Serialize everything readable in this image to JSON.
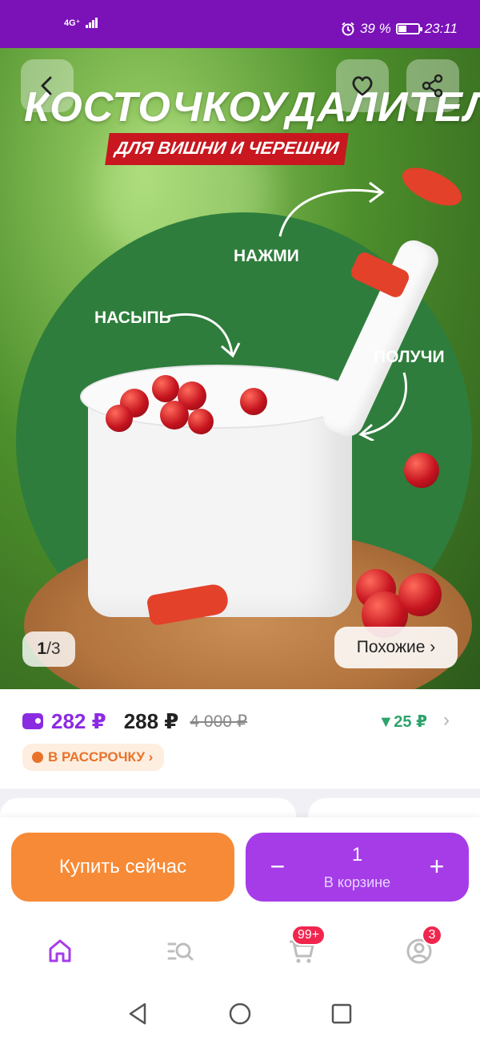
{
  "status_bar": {
    "network": "4G⁺",
    "battery": "39 %",
    "time": "23:11",
    "background": "#7a12b8"
  },
  "hero": {
    "title": "КОСТОЧКОУДАЛИТЕЛЬ",
    "subtitle": "ДЛЯ ВИШНИ И ЧЕРЕШНИ",
    "label_press": "НАЖМИ",
    "label_pour": "НАСЫПЬ",
    "label_get": "ПОЛУЧИ",
    "page_current": "1",
    "page_sep": "/",
    "page_total": "3",
    "similar_label": "Похожие ›",
    "back_icon": "chevron-left-icon",
    "favorite_icon": "heart-icon",
    "share_icon": "share-icon"
  },
  "price": {
    "wallet_price": "282 ₽",
    "main_price": "288 ₽",
    "old_price": "4 000 ₽",
    "price_drop": "▼25 ₽",
    "installment_label": "В РАССРОЧКУ ›",
    "wallet_color": "#8a2be2",
    "drop_color": "#2ea36b",
    "installment_color": "#e8722a"
  },
  "actions": {
    "buy_now_label": "Купить сейчас",
    "minus_label": "−",
    "plus_label": "+",
    "cart_quantity": "1",
    "cart_caption": "В корзине",
    "buy_color": "#f78a36",
    "cart_color": "#a63ce8"
  },
  "bottom_nav": {
    "items": [
      {
        "icon": "home-icon"
      },
      {
        "icon": "catalog-search-icon"
      },
      {
        "icon": "cart-icon",
        "badge": "99+"
      },
      {
        "icon": "profile-icon",
        "badge": "3"
      }
    ],
    "active_color": "#a63ce8"
  },
  "system_nav": {
    "items": [
      "back-triangle-icon",
      "home-circle-icon",
      "recents-square-icon"
    ]
  }
}
